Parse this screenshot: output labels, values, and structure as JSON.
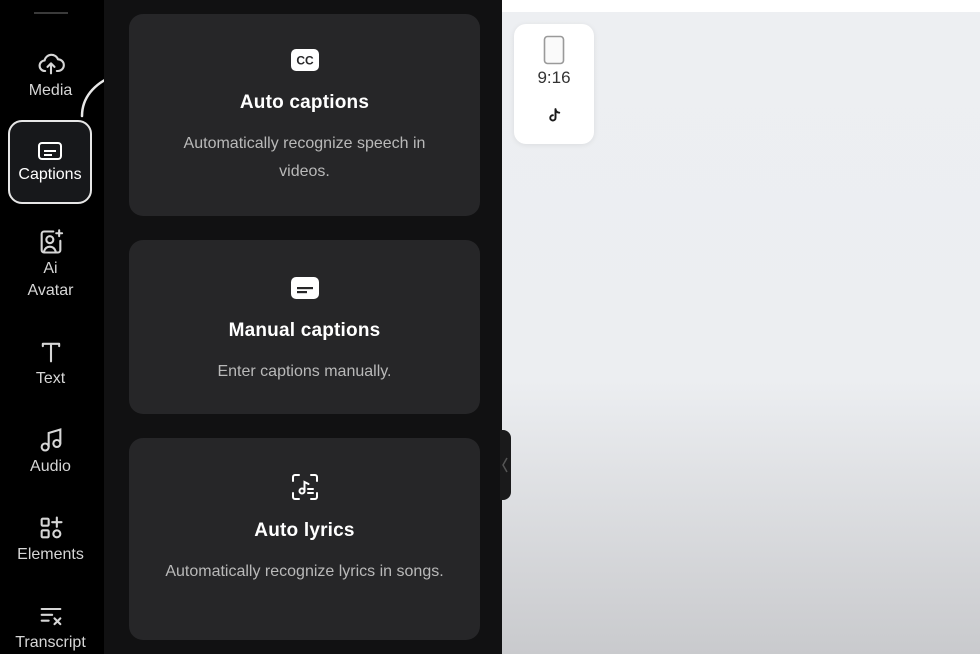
{
  "rail": {
    "items": [
      {
        "label": "Media",
        "icon": "cloud-upload-icon"
      },
      {
        "label": "Captions",
        "icon": "captions-icon",
        "active": true
      },
      {
        "label": "Ai\nAvatar",
        "label_line1": "Ai",
        "label_line2": "Avatar",
        "icon": "avatar-icon"
      },
      {
        "label": "Text",
        "icon": "text-icon"
      },
      {
        "label": "Audio",
        "icon": "music-note-icon"
      },
      {
        "label": "Elements",
        "icon": "elements-icon"
      },
      {
        "label": "Transcript",
        "icon": "transcript-icon"
      }
    ]
  },
  "panel": {
    "cards": [
      {
        "title": "Auto captions",
        "desc": "Automatically recognize speech in videos.",
        "icon": "cc-icon"
      },
      {
        "title": "Manual captions",
        "desc": "Enter captions manually.",
        "icon": "subtitle-icon"
      },
      {
        "title": "Auto lyrics",
        "desc": "Automatically recognize lyrics in songs.",
        "icon": "music-scan-icon"
      }
    ]
  },
  "canvas": {
    "ratio": "9:16",
    "platform_icon": "tiktok-icon"
  },
  "colors": {
    "rail_bg": "#000000",
    "panel_bg": "#111112",
    "card_bg": "#262628",
    "canvas_bg": "#eceef1"
  }
}
